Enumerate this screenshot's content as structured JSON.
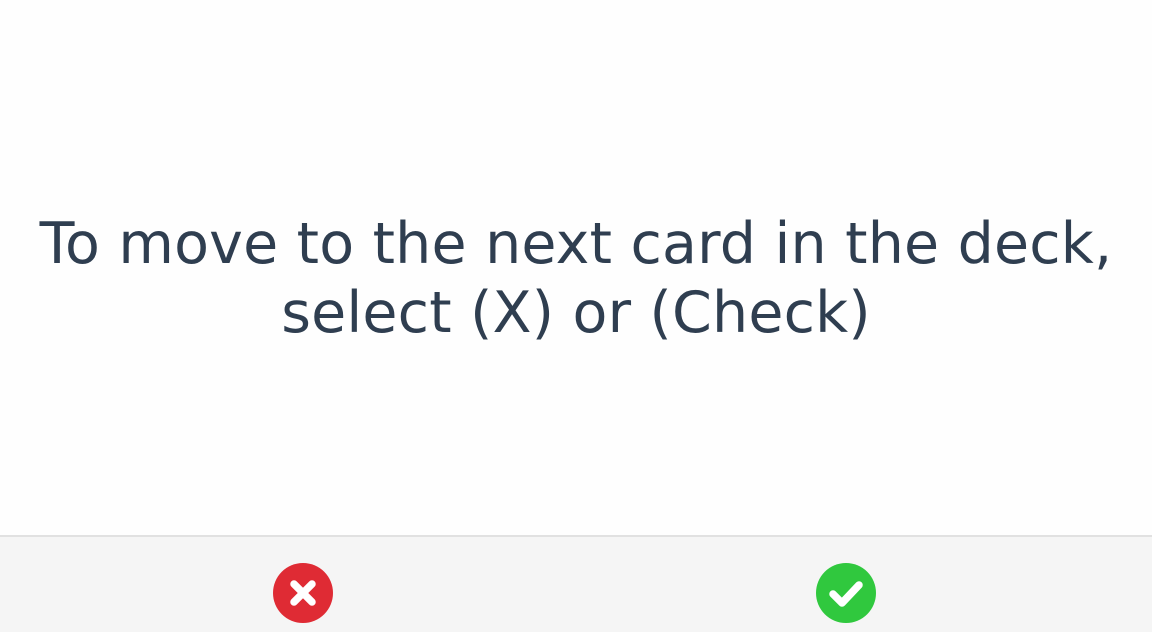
{
  "card": {
    "line1": "To move to the next card in the deck,",
    "line2": "select (X) or (Check)"
  },
  "actions": {
    "wrong": {
      "icon": "x-icon",
      "color": "#df2b34"
    },
    "right": {
      "icon": "check-icon",
      "color": "#30c83e"
    }
  },
  "colors": {
    "text": "#2f3e50",
    "bar_background": "#f5f5f5"
  }
}
